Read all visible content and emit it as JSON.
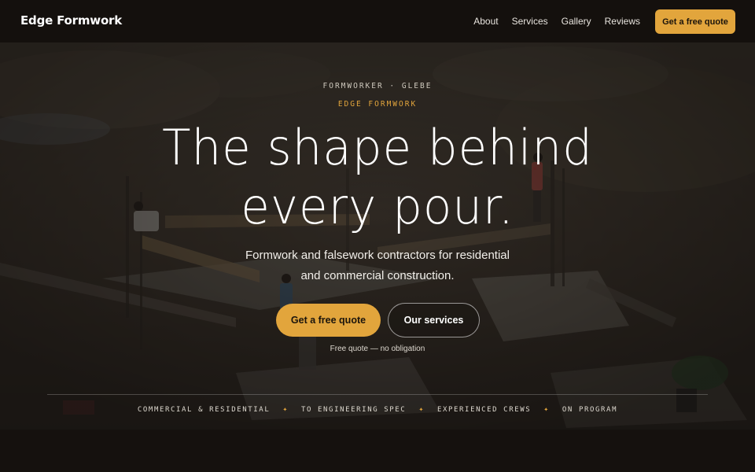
{
  "nav": {
    "brand": "Edge Formwork",
    "links": [
      "About",
      "Services",
      "Gallery",
      "Reviews"
    ],
    "cta": "Get a free quote"
  },
  "hero": {
    "kicker_location": "FORMWORKER · GLEBE",
    "kicker_brand": "EDGE FORMWORK",
    "headline_line1": "The shape behind",
    "headline_line2": "every pour.",
    "subtitle_line1": "Formwork and falsework contractors for residential",
    "subtitle_line2": "and commercial construction.",
    "primary_button": "Get a free quote",
    "secondary_button": "Our services",
    "note": "Free quote — no obligation",
    "features": [
      "COMMERCIAL & RESIDENTIAL",
      "TO ENGINEERING SPEC",
      "EXPERIENCED CREWS",
      "ON PROGRAM"
    ],
    "separator": "✦"
  },
  "colors": {
    "accent": "#e2a53c",
    "nav_bg": "#14100d",
    "page_bg": "#15110e"
  }
}
